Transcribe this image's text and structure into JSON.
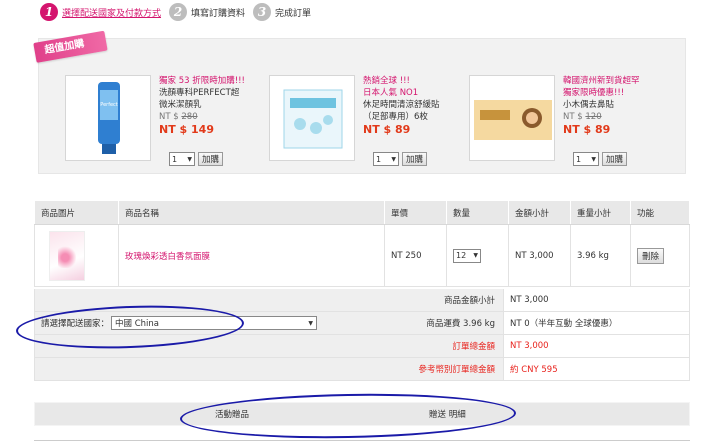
{
  "steps": [
    {
      "num": "1",
      "label": "選擇配送國家及付款方式"
    },
    {
      "num": "2",
      "label": "填寫訂購資料"
    },
    {
      "num": "3",
      "label": "完成訂單"
    }
  ],
  "addon": {
    "ribbon": "超值加購",
    "products": [
      {
        "promo1": "獨家 53 折限時加購!!!",
        "promo2": "",
        "name1": "洗顏專科PERFECT超",
        "name2": "微米潔顏乳",
        "old_price_label": "NT $",
        "old_price": "280",
        "new_price": "NT $ 149",
        "qty": "1",
        "add_label": "加購"
      },
      {
        "promo1": "熱銷全球 !!!",
        "promo2": "日本人氣 NO1",
        "name1": "休足時間清涼舒緩貼",
        "name2": "（足部專用）6枚",
        "old_price_label": "",
        "old_price": "",
        "new_price": "NT $ 89",
        "qty": "1",
        "add_label": "加購"
      },
      {
        "promo1": "韓國濟州新到貨超罕",
        "promo2": "獨家限時優惠!!!",
        "name1": "小木偶去鼻貼",
        "name2": "",
        "old_price_label": "NT $",
        "old_price": "120",
        "new_price": "NT $ 89",
        "qty": "1",
        "add_label": "加購"
      }
    ]
  },
  "cart": {
    "headers": [
      "商品圖片",
      "商品名稱",
      "單價",
      "數量",
      "金額小計",
      "重量小計",
      "功能"
    ],
    "rows": [
      {
        "name": "玫瑰煥彩透白香氛面膜",
        "unit_price": "NT 250",
        "qty": "12",
        "subtotal": "NT 3,000",
        "weight": "3.96 kg",
        "action": "刪除"
      }
    ]
  },
  "summary": {
    "country_label": "請選擇配送國家：",
    "country_value": "中國 China",
    "rows": [
      {
        "label": "商品金額小計",
        "value": "NT 3,000",
        "red": false
      },
      {
        "label": "商品運費 3.96 kg",
        "value": "NT 0（半年互動 全球優惠）",
        "red": false
      },
      {
        "label": "訂單總金額",
        "value": "NT 3,000",
        "red": true
      },
      {
        "label": "參考幣別訂單總金額",
        "value": "約 CNY 595",
        "red": true
      }
    ]
  },
  "gift": {
    "col1": "活動贈品",
    "col2": "贈送 明細"
  },
  "colors": {
    "accent": "#d4156e",
    "price_red": "#e23a1a",
    "annotation_blue": "#1a1aa8"
  }
}
